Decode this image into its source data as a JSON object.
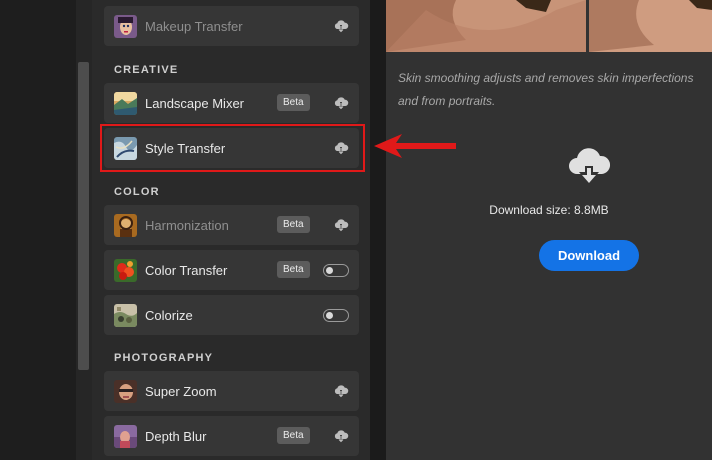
{
  "sections": {
    "creative": "CREATIVE",
    "color": "COLOR",
    "photography": "PHOTOGRAPHY"
  },
  "filters": [
    {
      "label": "Makeup Transfer",
      "state": "cloud",
      "dim": true
    },
    {
      "label": "Landscape Mixer",
      "badge": "Beta",
      "state": "cloud"
    },
    {
      "label": "Style Transfer",
      "state": "cloud",
      "highlighted": true
    },
    {
      "label": "Harmonization",
      "badge": "Beta",
      "state": "cloud",
      "dim": true
    },
    {
      "label": "Color Transfer",
      "badge": "Beta",
      "state": "toggle-off"
    },
    {
      "label": "Colorize",
      "state": "toggle-off"
    },
    {
      "label": "Super Zoom",
      "state": "cloud"
    },
    {
      "label": "Depth Blur",
      "badge": "Beta",
      "state": "cloud"
    }
  ],
  "details": {
    "description": "Skin smoothing adjusts and removes skin imperfections and from portraits.",
    "download_size": "Download size: 8.8MB",
    "download_label": "Download"
  },
  "colors": {
    "accent": "#1473e6",
    "highlight": "#e01919"
  },
  "icons": [
    "cloud-download-icon",
    "toggle-switch",
    "arrow-left-icon"
  ]
}
